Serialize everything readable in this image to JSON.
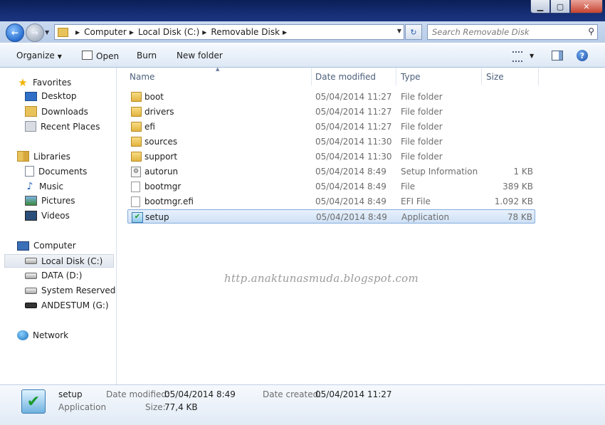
{
  "window": {
    "minimize": "▁",
    "maximize": "▢",
    "close": "✕"
  },
  "address": {
    "crumbs": [
      "Computer",
      "Local Disk (C:)",
      "Removable Disk"
    ]
  },
  "search": {
    "placeholder": "Search Removable Disk"
  },
  "toolbar": {
    "organize": "Organize",
    "open": "Open",
    "burn": "Burn",
    "new_folder": "New folder"
  },
  "sidebar": {
    "favorites": {
      "title": "Favorites",
      "items": [
        "Desktop",
        "Downloads",
        "Recent Places"
      ]
    },
    "libraries": {
      "title": "Libraries",
      "items": [
        "Documents",
        "Music",
        "Pictures",
        "Videos"
      ]
    },
    "computer": {
      "title": "Computer",
      "items": [
        "Local Disk (C:)",
        "DATA (D:)",
        "System Reserved (F:)",
        "ANDESTUM (G:)"
      ]
    },
    "network": {
      "title": "Network"
    }
  },
  "columns": {
    "name": "Name",
    "date": "Date modified",
    "type": "Type",
    "size": "Size"
  },
  "files": [
    {
      "name": "boot",
      "date": "05/04/2014 11:27",
      "type": "File folder",
      "size": "",
      "icon": "folder-icon"
    },
    {
      "name": "drivers",
      "date": "05/04/2014 11:27",
      "type": "File folder",
      "size": "",
      "icon": "folder-icon"
    },
    {
      "name": "efi",
      "date": "05/04/2014 11:27",
      "type": "File folder",
      "size": "",
      "icon": "folder-icon"
    },
    {
      "name": "sources",
      "date": "05/04/2014 11:30",
      "type": "File folder",
      "size": "",
      "icon": "folder-icon"
    },
    {
      "name": "support",
      "date": "05/04/2014 11:30",
      "type": "File folder",
      "size": "",
      "icon": "folder-icon"
    },
    {
      "name": "autorun",
      "date": "05/04/2014 8:49",
      "type": "Setup Information",
      "size": "1 KB",
      "icon": "setup-info-icon"
    },
    {
      "name": "bootmgr",
      "date": "05/04/2014 8:49",
      "type": "File",
      "size": "389 KB",
      "icon": "file-icon"
    },
    {
      "name": "bootmgr.efi",
      "date": "05/04/2014 8:49",
      "type": "EFI File",
      "size": "1.092 KB",
      "icon": "file-icon"
    },
    {
      "name": "setup",
      "date": "05/04/2014 8:49",
      "type": "Application",
      "size": "78 KB",
      "icon": "setup-icon",
      "selected": true
    }
  ],
  "watermark": "http.anaktunasmuda.blogspot.com",
  "details": {
    "name": "setup",
    "type": "Application",
    "date_modified_label": "Date modified:",
    "date_modified": "05/04/2014 8:49",
    "date_created_label": "Date created:",
    "date_created": "05/04/2014 11:27",
    "size_label": "Size:",
    "size": "77,4 KB"
  },
  "colors": {
    "titlebar": "#152d73",
    "selection": "#cfe1f6",
    "toolbar": "#dde8f5"
  }
}
